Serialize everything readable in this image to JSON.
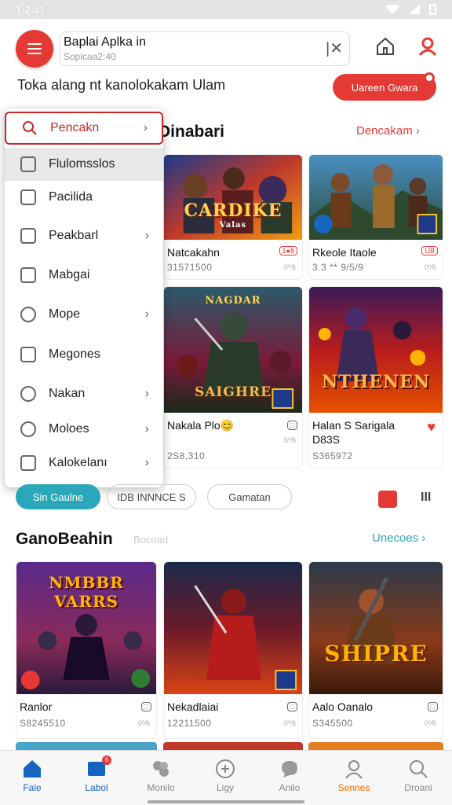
{
  "status_bar": {
    "time": "1:2:41"
  },
  "search": {
    "title": "Baplai Aplka in",
    "subtitle": "Sopicaa2:40",
    "clear_icon": "clear-icon"
  },
  "promo": {
    "text": "Toka alang nt kanolokakam Ulam",
    "button": "Uareen Gwara"
  },
  "section1": {
    "title": "Dinabari",
    "link": "Dencakam ›"
  },
  "dropdown": {
    "items": [
      {
        "label": "Pencakn",
        "icon": "search-icon",
        "chevron": "›"
      },
      {
        "label": "Flulomsslos",
        "icon": "tag-icon",
        "chevron": ""
      },
      {
        "label": "Pacilida",
        "icon": "bag-icon",
        "chevron": ""
      },
      {
        "label": "Peakbarl",
        "icon": "thumbs-up-icon",
        "chevron": "›"
      },
      {
        "label": "Mabgai",
        "icon": "bookmark-icon",
        "chevron": ""
      },
      {
        "label": "Mope",
        "icon": "compass-icon",
        "chevron": "›"
      },
      {
        "label": "Megones",
        "icon": "document-icon",
        "chevron": ""
      },
      {
        "label": "Nakan",
        "icon": "at-icon",
        "chevron": "›"
      },
      {
        "label": "Moloes",
        "icon": "magnify-icon",
        "chevron": "›"
      },
      {
        "label": "Kalokelanı",
        "icon": "puzzle-icon",
        "chevron": "›"
      }
    ]
  },
  "games_row1": [
    {
      "title": "Natcakahn",
      "sub": "31571500",
      "badge": "1●8",
      "tiny": "0⁰⁄6",
      "art": "CARDIKE",
      "art_sub": "Valas"
    },
    {
      "title": "Rkeole Itaole",
      "sub": "3.3 ** 9/5/9",
      "badge": "UB",
      "tiny": "0⁰⁄6",
      "art": "",
      "art_sub": ""
    }
  ],
  "games_row2": [
    {
      "title": "Nakala Plo😊",
      "sub": "2S8,310",
      "badge": "□",
      "tiny": "5⁰⁄6",
      "art": "SAIGHRE",
      "art_sub": ""
    },
    {
      "title": "Halan S Sarigala",
      "title2": "D83S",
      "sub": "S365972",
      "badge": "♥",
      "tiny": "",
      "art": "NTHENEN",
      "art_sub": ""
    }
  ],
  "chips": {
    "chip1": "Sin Gaulne",
    "chip2": "IDB INNNCE S",
    "chip3": "Gamatan"
  },
  "section2": {
    "title": "GanoBeahin",
    "faded": "Bocoad",
    "link": "Unecoes ›"
  },
  "games_row3": [
    {
      "title": "Ranlor",
      "sub": "S8245510",
      "tiny": "0⁰⁄6",
      "art": "NMBBR VARRS"
    },
    {
      "title": "Nekadlaiai",
      "sub": "12211500",
      "tiny": "0⁰⁄6",
      "art": ""
    },
    {
      "title": "Aalo Oanalo",
      "sub": "S345500",
      "tiny": "0⁰⁄6",
      "art": "SHIPRE"
    }
  ],
  "nav": [
    {
      "label": "Fale",
      "icon": "home-icon"
    },
    {
      "label": "Labol",
      "icon": "library-icon",
      "badge": "6"
    },
    {
      "label": "Monilo",
      "icon": "puzzle-icon"
    },
    {
      "label": "Ligy",
      "icon": "compass-icon"
    },
    {
      "label": "Anilo",
      "icon": "chat-icon"
    },
    {
      "label": "Sennes",
      "icon": "profile-icon"
    },
    {
      "label": "Droani",
      "icon": "search-icon"
    }
  ],
  "colors": {
    "accent": "#e53935",
    "teal": "#2aa7b8",
    "nav_active": "#1565c0"
  }
}
